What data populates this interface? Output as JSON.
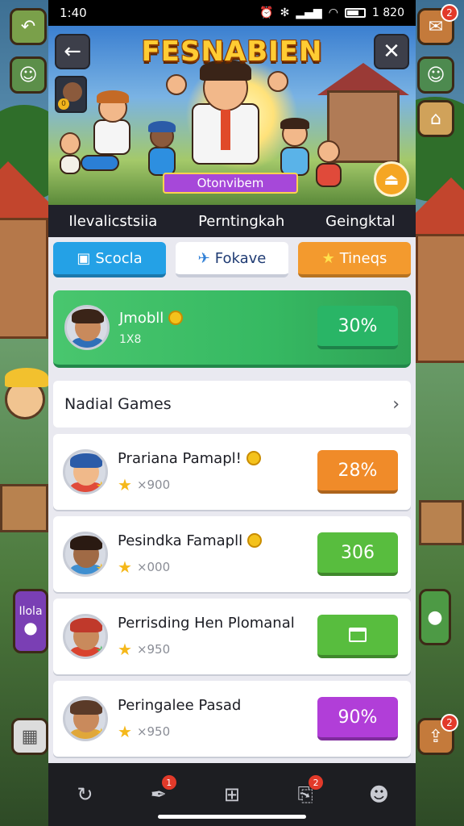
{
  "status_bar": {
    "time": "1:40",
    "right_text": "1 820"
  },
  "header": {
    "game_title": "FESNABIEN",
    "banner_text": "Otonvibem"
  },
  "tabs": [
    {
      "label": "Ilevalicstsiia"
    },
    {
      "label": "Perntingkah"
    },
    {
      "label": "Geingktal"
    }
  ],
  "filters": [
    {
      "label": "Scocla",
      "icon": "terminal-icon",
      "color": "#24a1e6"
    },
    {
      "label": "Fokave",
      "icon": "plane-icon",
      "color": "#ffffff"
    },
    {
      "label": "Tineqs",
      "icon": "star-icon",
      "color": "#f39a2e"
    }
  ],
  "featured": {
    "name": "Jmobll",
    "sub": "1X8",
    "percent": "30%"
  },
  "section": {
    "title": "Nadial Games"
  },
  "players": [
    {
      "name": "Prariana Pamapl!",
      "score": "×900",
      "action": "28%",
      "color": "#f08b29"
    },
    {
      "name": "Pesindka Famapll",
      "score": "×000",
      "action": "306",
      "color": "#58bd3e"
    },
    {
      "name": "Perrisding Hen Plomanal",
      "score": "×950",
      "action": "",
      "color": "#58bd3e"
    },
    {
      "name": "Peringalee Pasad",
      "score": "×950",
      "action": "90%",
      "color": "#b13ed8"
    }
  ],
  "bottom_nav": [
    {
      "icon": "refresh-icon",
      "badge": ""
    },
    {
      "icon": "feather-icon",
      "badge": "1"
    },
    {
      "icon": "grid-icon",
      "badge": ""
    },
    {
      "icon": "inbox-icon",
      "badge": "2"
    },
    {
      "icon": "profile-icon",
      "badge": ""
    }
  ],
  "side": {
    "right_top_badge": "2",
    "right_bottom_badge": "2",
    "left_label": "Ilola"
  }
}
